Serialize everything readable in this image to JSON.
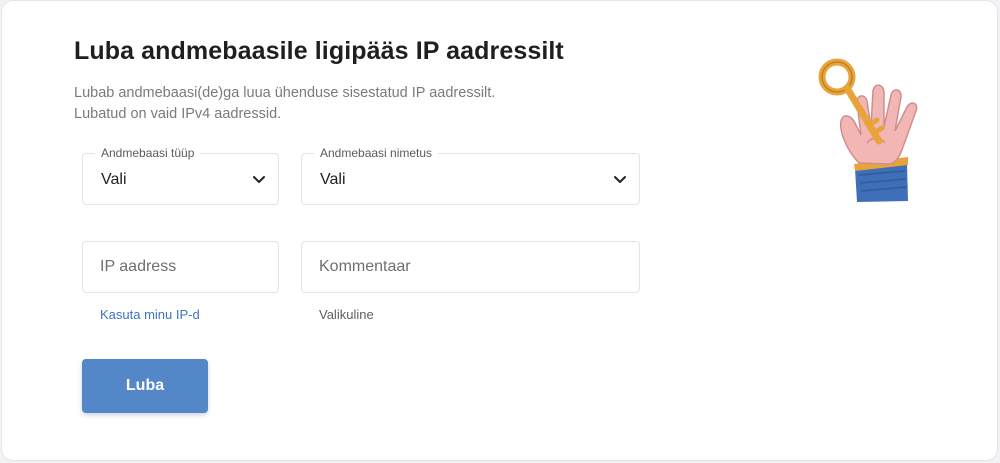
{
  "page": {
    "title": "Luba andmebaasile ligipääs IP aadressilt",
    "description_line1": "Lubab andmebaasi(de)ga luua ühenduse sisestatud IP aadressilt.",
    "description_line2": "Lubatud on vaid IPv4 aadressid."
  },
  "form": {
    "db_type": {
      "label": "Andmebaasi tüüp",
      "value": "Vali"
    },
    "db_name": {
      "label": "Andmebaasi nimetus",
      "value": "Vali"
    },
    "ip_address": {
      "placeholder": "IP aadress",
      "hint_link": "Kasuta minu IP-d"
    },
    "comment": {
      "placeholder": "Kommentaar",
      "hint": "Valikuline"
    },
    "submit_label": "Luba"
  },
  "colors": {
    "primary": "#5387c8",
    "link": "#3f74c0",
    "illustration_key": "#e8a43a",
    "illustration_sleeve": "#3f6fb8",
    "illustration_hand": "#f2b6b4"
  },
  "illustration": {
    "icon": "hand-holding-key-illustration"
  }
}
